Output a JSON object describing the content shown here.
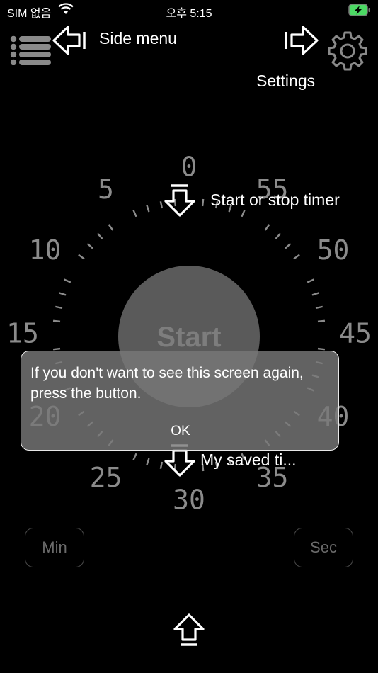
{
  "status_bar": {
    "carrier": "SIM 없음",
    "time": "오후 5:15",
    "wifi_icon": "wifi-icon",
    "battery_icon": "battery-charging-icon",
    "battery_color": "#4cd964"
  },
  "hints": {
    "side_menu": "Side menu",
    "settings": "Settings",
    "start_stop": "Start or stop timer",
    "saved": "My saved ti..."
  },
  "dial": {
    "labels": [
      "0",
      "5",
      "10",
      "15",
      "20",
      "25",
      "30",
      "35",
      "40",
      "45",
      "50",
      "55"
    ],
    "center_label": "Start",
    "tick_color": "#8b8b8b"
  },
  "buttons": {
    "min": "Min",
    "sec": "Sec"
  },
  "dialog": {
    "message": "If you don't want to see this screen again, press the button.",
    "ok": "OK"
  },
  "icons": {
    "menu": "list-menu-icon",
    "settings": "gear-icon",
    "arrow": "outline-arrow-icon"
  }
}
